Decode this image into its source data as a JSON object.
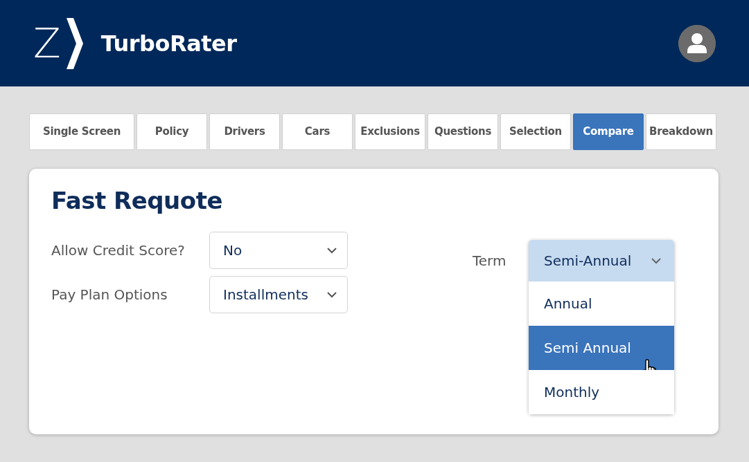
{
  "header": {
    "logo_letter": "Z",
    "app_name": "TurboRater"
  },
  "tabs": [
    {
      "label": "Single Screen",
      "selected": false
    },
    {
      "label": "Policy",
      "selected": false
    },
    {
      "label": "Drivers",
      "selected": false
    },
    {
      "label": "Cars",
      "selected": false
    },
    {
      "label": "Exclusions",
      "selected": false
    },
    {
      "label": "Questions",
      "selected": false
    },
    {
      "label": "Selection",
      "selected": false
    },
    {
      "label": "Compare",
      "selected": true
    },
    {
      "label": "Breakdown",
      "selected": false
    }
  ],
  "panel": {
    "title": "Fast Requote",
    "fields": [
      {
        "label": "Allow Credit Score?",
        "value": "No"
      },
      {
        "label": "Pay Plan Options",
        "value": "Installments"
      }
    ],
    "term": {
      "label": "Term",
      "value": "Semi-Annual",
      "expanded": true,
      "options": [
        {
          "label": "Annual",
          "selected": false
        },
        {
          "label": "Semi Annual",
          "selected": true
        },
        {
          "label": "Monthly",
          "selected": false
        }
      ]
    }
  }
}
